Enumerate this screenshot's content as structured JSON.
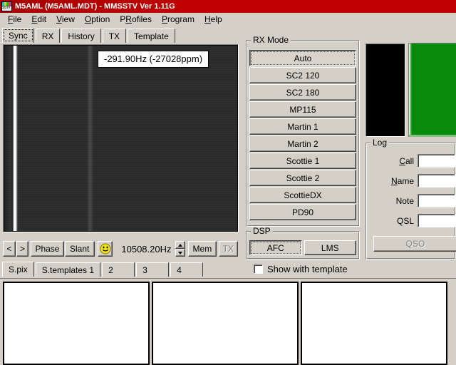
{
  "window": {
    "title": "M5AML (M5AML.MDT) - MMSSTV Ver 1.11G",
    "icon": "sstv-app-icon"
  },
  "menubar": {
    "items": [
      {
        "label": "File"
      },
      {
        "label": "Edit"
      },
      {
        "label": "View"
      },
      {
        "label": "Option"
      },
      {
        "label": "PRofiles"
      },
      {
        "label": "Program"
      },
      {
        "label": "Help"
      }
    ]
  },
  "tabs": {
    "items": [
      {
        "label": "Sync",
        "selected": true
      },
      {
        "label": "RX",
        "selected": false
      },
      {
        "label": "History",
        "selected": false
      },
      {
        "label": "TX",
        "selected": false
      },
      {
        "label": "Template",
        "selected": false
      }
    ]
  },
  "sync": {
    "tooltip": "-291.90Hz (-27028ppm)",
    "toolbar": {
      "prev_label": "<",
      "next_label": ">",
      "phase_label": "Phase",
      "slant_label": "Slant",
      "smiley_label": "smiley-face",
      "frequency": "10508.20Hz",
      "mem_label": "Mem",
      "tx_label": "TX"
    }
  },
  "rx_mode": {
    "title": "RX Mode",
    "modes": [
      {
        "label": "Auto",
        "selected": true
      },
      {
        "label": "SC2 120",
        "selected": false
      },
      {
        "label": "SC2 180",
        "selected": false
      },
      {
        "label": "MP115",
        "selected": false
      },
      {
        "label": "Martin 1",
        "selected": false
      },
      {
        "label": "Martin 2",
        "selected": false
      },
      {
        "label": "Scottie 1",
        "selected": false
      },
      {
        "label": "Scottie 2",
        "selected": false
      },
      {
        "label": "ScottieDX",
        "selected": false
      },
      {
        "label": "PD90",
        "selected": false
      }
    ]
  },
  "dsp": {
    "title": "DSP",
    "buttons": [
      {
        "label": "AFC",
        "selected": true
      },
      {
        "label": "LMS",
        "selected": false
      }
    ]
  },
  "preview": {
    "black_pane": "#000000",
    "green_pane": "#0a8a0a"
  },
  "log": {
    "title": "Log",
    "fields": [
      {
        "label": "Call",
        "accel": "C",
        "rest": "all",
        "value": ""
      },
      {
        "label": "Name",
        "accel": "N",
        "rest": "ame",
        "value": ""
      },
      {
        "label": "Note",
        "accel": "",
        "rest": "Note",
        "value": ""
      },
      {
        "label": "QSL",
        "accel": "",
        "rest": "QSL",
        "value": ""
      }
    ],
    "qso_label": "QSO"
  },
  "bottom_tabs": {
    "items": [
      {
        "label": "S.pix",
        "selected": true
      },
      {
        "label": "S.templates 1",
        "selected": false
      },
      {
        "label": "2",
        "selected": false
      },
      {
        "label": "3",
        "selected": false
      },
      {
        "label": "4",
        "selected": false
      }
    ]
  },
  "show_with_template": {
    "label": "Show with template",
    "checked": false
  },
  "thumbnails": {
    "count": 3
  }
}
